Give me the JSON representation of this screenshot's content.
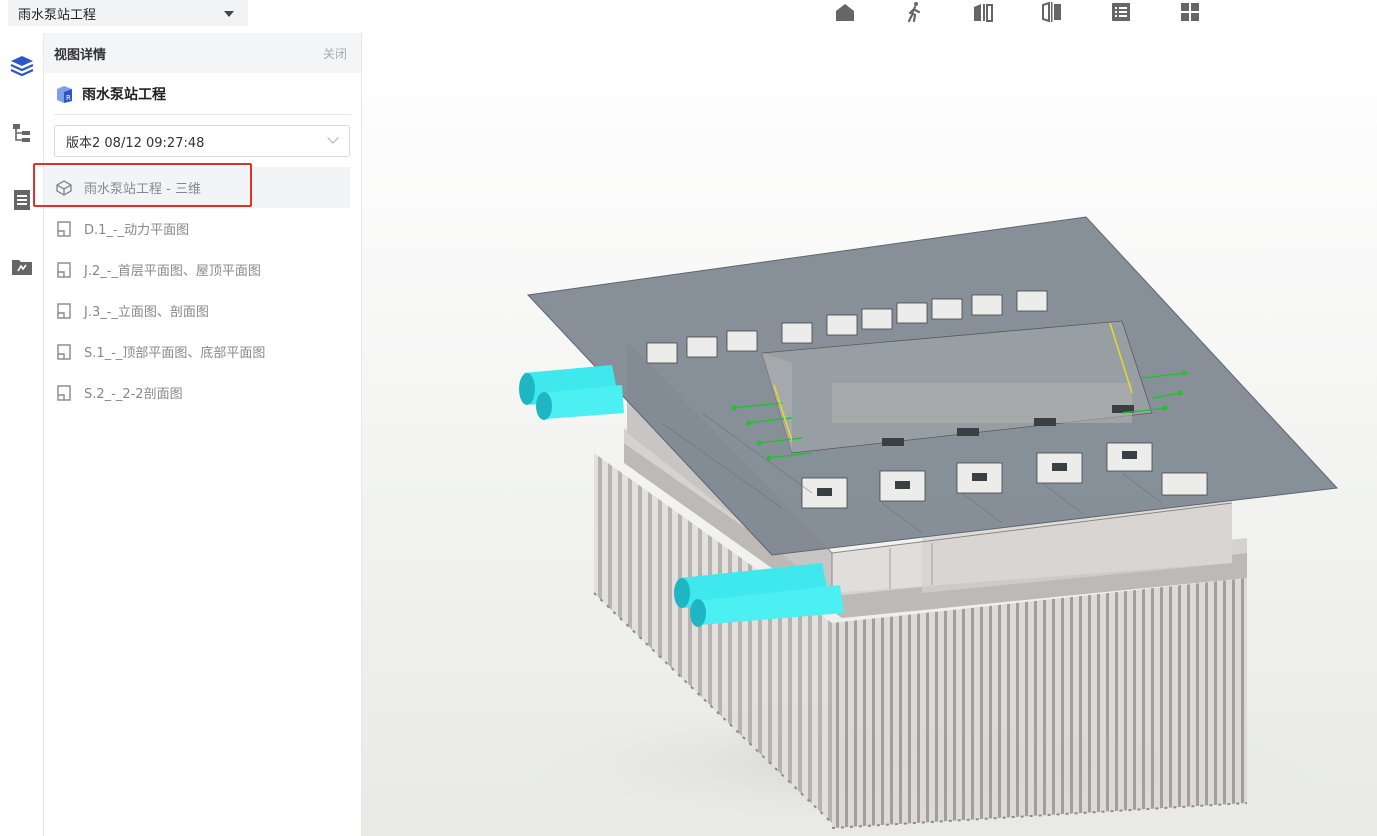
{
  "topbar": {
    "project_name": "雨水泵站工程",
    "tools": [
      {
        "icon": "home-icon"
      },
      {
        "icon": "walk-icon"
      },
      {
        "icon": "split-view-icon"
      },
      {
        "icon": "section-box-icon"
      },
      {
        "icon": "list-icon"
      },
      {
        "icon": "grid-icon"
      }
    ]
  },
  "rail": {
    "items": [
      {
        "icon": "layers-icon",
        "active": true
      },
      {
        "icon": "tree-icon"
      },
      {
        "icon": "document-icon"
      },
      {
        "icon": "folder-icon"
      }
    ]
  },
  "panel": {
    "title": "视图详情",
    "close_label": "关闭",
    "model_name": "雨水泵站工程",
    "version_value": "版本2 08/12 09:27:48",
    "views": [
      {
        "label": "雨水泵站工程 - 三维",
        "icon": "3d-view-icon",
        "active": true
      },
      {
        "label": "D.1_-_动力平面图",
        "icon": "drawing-icon"
      },
      {
        "label": "J.2_-_首层平面图、屋顶平面图",
        "icon": "drawing-icon"
      },
      {
        "label": "J.3_-_立面图、剖面图",
        "icon": "drawing-icon"
      },
      {
        "label": "S.1_-_顶部平面图、底部平面图",
        "icon": "drawing-icon"
      },
      {
        "label": "S.2_-_2-2剖面图",
        "icon": "drawing-icon"
      }
    ]
  },
  "colors": {
    "accent": "#2c56c8",
    "highlight": "#e0302a",
    "pipe": "#3ee8ec",
    "slab": "#7d8790"
  }
}
